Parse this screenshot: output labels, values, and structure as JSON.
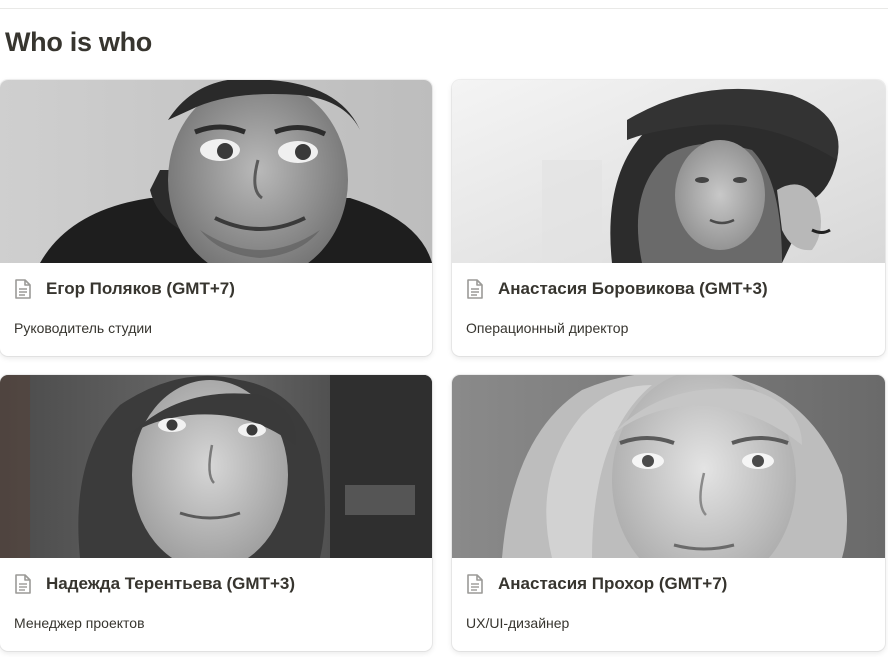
{
  "section": {
    "title": "Who is who"
  },
  "people": [
    {
      "name": "Егор Поляков (GMT+7)",
      "role": "Руководитель студии"
    },
    {
      "name": "Анастасия Боровикова (GMT+3)",
      "role": "Операционный директор"
    },
    {
      "name": "Надежда Терентьева (GMT+3)",
      "role": "Менеджер проектов"
    },
    {
      "name": "Анастасия Прохор (GMT+7)",
      "role": "UX/UI-дизайнер"
    }
  ],
  "icons": {
    "page": "page-icon"
  },
  "colors": {
    "text": "#37352f",
    "card_border": "#e9e9e7",
    "background": "#ffffff"
  }
}
